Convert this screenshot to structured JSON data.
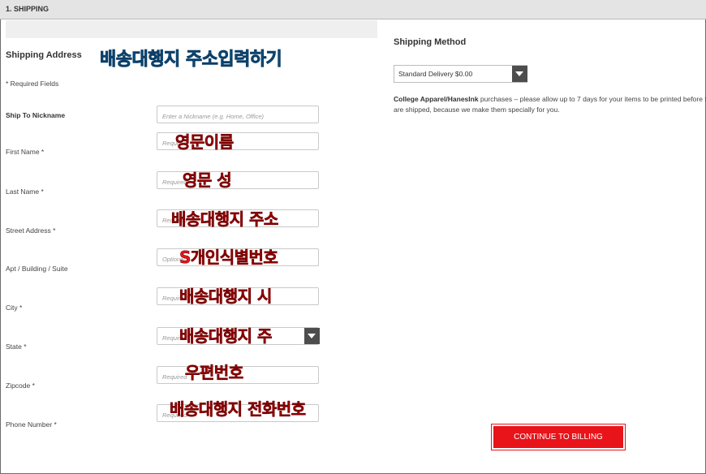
{
  "section": {
    "title": "1. SHIPPING"
  },
  "address": {
    "heading": "Shipping Address",
    "annotation": "배송대행지 주소입력하기",
    "required_note": "* Required Fields",
    "fields": [
      {
        "label": "Ship To Nickname",
        "placeholder": "Enter a Nickname (e.g. Home, Office)",
        "annotation": ""
      },
      {
        "label": "First Name *",
        "placeholder": "Required",
        "annotation": "영문이름"
      },
      {
        "label": "Last Name *",
        "placeholder": "Required",
        "annotation": "영문 성"
      },
      {
        "label": "Street Address *",
        "placeholder": "Required",
        "annotation": "배송대행지 주소"
      },
      {
        "label": "Apt / Building / Suite",
        "placeholder": "Optional",
        "annotation": "S개인식별번호"
      },
      {
        "label": "City *",
        "placeholder": "Required",
        "annotation": "배송대행지 시"
      },
      {
        "label": "State *",
        "placeholder": "Required",
        "annotation": "배송대행지 주"
      },
      {
        "label": "Zipcode *",
        "placeholder": "Required",
        "annotation": "우편번호"
      },
      {
        "label": "Phone Number *",
        "placeholder": "Required",
        "annotation": "배송대행지 전화번호"
      }
    ]
  },
  "method": {
    "heading": "Shipping Method",
    "selected": "Standard Delivery $0.00",
    "note_bold": "College Apparel/HanesInk",
    "note_text": " purchases – please allow up to 7 days for your items to be printed before they are shipped, because we make them specially for you."
  },
  "continue_label": "CONTINUE TO BILLING",
  "colors": {
    "accent": "#e8141a",
    "annotation_red": "#e8141a",
    "annotation_blue": "#13a8e0",
    "header_bg": "#e4e4e4"
  }
}
